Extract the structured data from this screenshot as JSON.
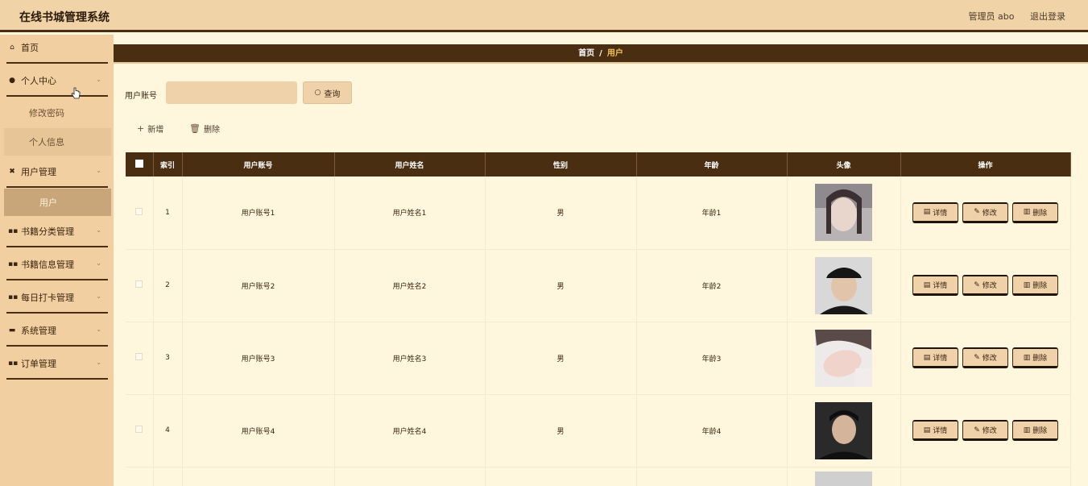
{
  "header": {
    "app_title": "在线书城管理系统",
    "admin_label": "管理员 abo",
    "logout_label": "退出登录"
  },
  "sidebar": {
    "home": "首页",
    "personal_center": "个人中心",
    "change_password": "修改密码",
    "personal_info": "个人信息",
    "user_management": "用户管理",
    "user_sub": "用户",
    "book_category": "书籍分类管理",
    "book_info": "书籍信息管理",
    "daily_checkin": "每日打卡管理",
    "system_management": "系统管理",
    "order_management": "订单管理"
  },
  "breadcrumb": {
    "home": "首页",
    "separator": "/",
    "current": "用户"
  },
  "search": {
    "label": "用户账号",
    "value": "",
    "button": "查询"
  },
  "actions": {
    "add": "新增",
    "delete": "删除"
  },
  "table": {
    "headers": {
      "index": "索引",
      "account": "用户账号",
      "name": "用户姓名",
      "gender": "性别",
      "age": "年龄",
      "avatar": "头像",
      "ops": "操作"
    },
    "rows": [
      {
        "index": "1",
        "account": "用户账号1",
        "name": "用户姓名1",
        "gender": "男",
        "age": "年龄1"
      },
      {
        "index": "2",
        "account": "用户账号2",
        "name": "用户姓名2",
        "gender": "男",
        "age": "年龄2"
      },
      {
        "index": "3",
        "account": "用户账号3",
        "name": "用户姓名3",
        "gender": "男",
        "age": "年龄3"
      },
      {
        "index": "4",
        "account": "用户账号4",
        "name": "用户姓名4",
        "gender": "男",
        "age": "年龄4"
      }
    ],
    "row_buttons": {
      "detail": "详情",
      "edit": "修改",
      "delete": "删除"
    }
  },
  "colors": {
    "primary": "#4a2e12",
    "sidebar_bg": "#f2cfa0",
    "page_bg": "#fef6dd",
    "accent": "#f3c35a"
  }
}
